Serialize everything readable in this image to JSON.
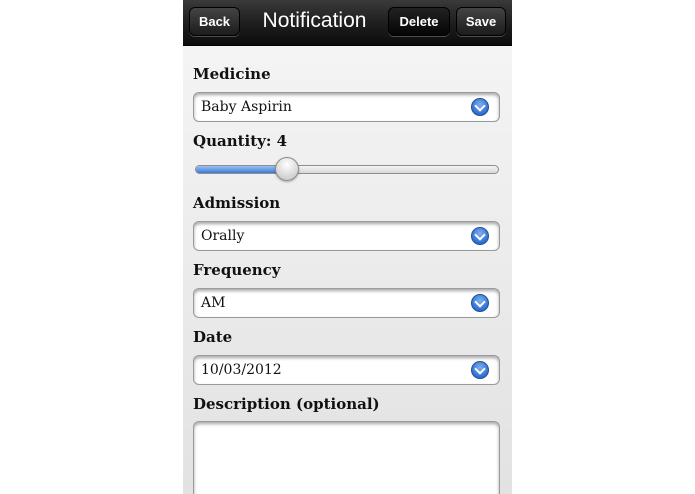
{
  "navbar": {
    "back_label": "Back",
    "title": "Notification",
    "delete_label": "Delete",
    "save_label": "Save"
  },
  "form": {
    "medicine": {
      "label": "Medicine",
      "value": "Baby Aspirin"
    },
    "quantity": {
      "label": "Quantity: 4",
      "value": 4,
      "slider_fraction": 0.3
    },
    "admission": {
      "label": "Admission",
      "value": "Orally"
    },
    "frequency": {
      "label": "Frequency",
      "value": "AM"
    },
    "date": {
      "label": "Date",
      "value": "10/03/2012"
    },
    "description": {
      "label": "Description (optional)",
      "value": ""
    }
  },
  "icons": {
    "select_indicator": "chevron-down-icon"
  },
  "colors": {
    "accent": "#3a7ad8",
    "navbar": "#1f1f1f"
  }
}
